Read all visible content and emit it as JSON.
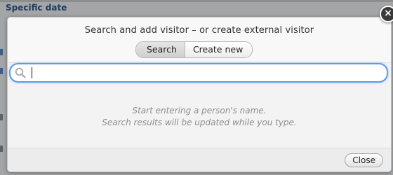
{
  "background": {
    "heading": "Specific date"
  },
  "dialog": {
    "title": "Search and add visitor – or create external visitor",
    "tabs": [
      {
        "label": "Search",
        "active": true
      },
      {
        "label": "Create new",
        "active": false
      }
    ],
    "search": {
      "value": "",
      "placeholder": "",
      "icon": "search-icon"
    },
    "hint": {
      "line1": "Start entering a person's name.",
      "line2": "Search results will be updated while you type."
    },
    "close_label": "Close",
    "close_x": "×"
  },
  "colors": {
    "focus_ring": "#5b9ee6",
    "dialog_bg": "#f3f3f3",
    "heading": "#1f3b5e"
  }
}
